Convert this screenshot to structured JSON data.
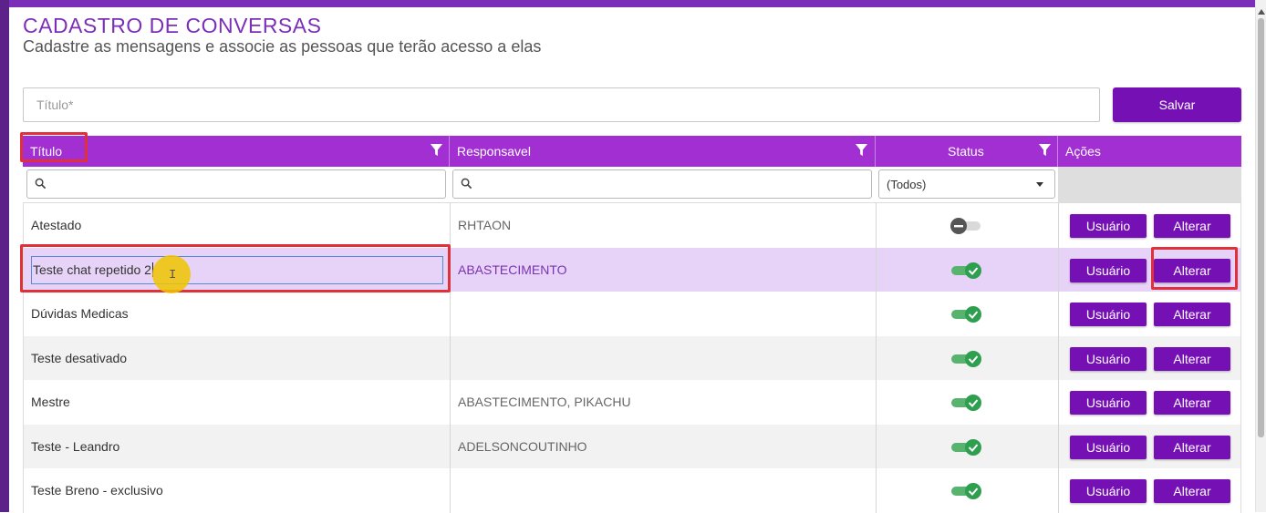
{
  "page": {
    "title": "CADASTRO DE CONVERSAS",
    "subtitle": "Cadastre as mensagens e associe as pessoas que terão acesso a elas"
  },
  "form": {
    "title_placeholder": "Título*",
    "save_label": "Salvar"
  },
  "table": {
    "columns": [
      "Título",
      "Responsavel",
      "Status",
      "Ações"
    ],
    "status_filter_selected": "(Todos)",
    "rows": [
      {
        "title": "Atestado",
        "responsavel": "RHTAON",
        "status": "off",
        "user_btn": "Usuário",
        "alter_btn": "Alterar"
      },
      {
        "title": "Teste chat repetido 2",
        "responsavel": "ABASTECIMENTO",
        "status": "on",
        "user_btn": "Usuário",
        "alter_btn": "Alterar"
      },
      {
        "title": "Dúvidas Medicas",
        "responsavel": "",
        "status": "on",
        "user_btn": "Usuário",
        "alter_btn": "Alterar"
      },
      {
        "title": "Teste desativado",
        "responsavel": "",
        "status": "on",
        "user_btn": "Usuário",
        "alter_btn": "Alterar"
      },
      {
        "title": "Mestre",
        "responsavel": "ABASTECIMENTO, PIKACHU",
        "status": "on",
        "user_btn": "Usuário",
        "alter_btn": "Alterar"
      },
      {
        "title": "Teste - Leandro",
        "responsavel": "ADELSONCOUTINHO",
        "status": "on",
        "user_btn": "Usuário",
        "alter_btn": "Alterar"
      },
      {
        "title": "Teste Breno - exclusivo",
        "responsavel": "",
        "status": "on",
        "user_btn": "Usuário",
        "alter_btn": "Alterar"
      }
    ]
  },
  "colors": {
    "accent": "#7510b5",
    "header": "#a22fd1",
    "selected_row": "#e8d3f8",
    "toggle_on": "#2e9e4f",
    "toggle_off": "#555555",
    "highlight": "#e0303a"
  }
}
